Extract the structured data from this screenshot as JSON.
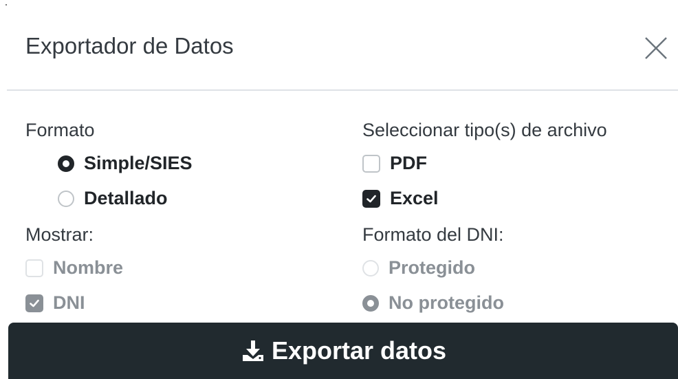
{
  "dialog": {
    "title": "Exportador de Datos",
    "close_icon": "close-icon"
  },
  "format": {
    "label": "Formato",
    "options": [
      {
        "label": "Simple/SIES",
        "checked": true,
        "disabled": false
      },
      {
        "label": "Detallado",
        "checked": false,
        "disabled": false
      }
    ]
  },
  "file_types": {
    "label": "Seleccionar tipo(s) de archivo",
    "options": [
      {
        "label": "PDF",
        "checked": false,
        "disabled": false
      },
      {
        "label": "Excel",
        "checked": true,
        "disabled": false
      }
    ]
  },
  "show": {
    "label": "Mostrar:",
    "options": [
      {
        "label": "Nombre",
        "checked": false,
        "disabled": true
      },
      {
        "label": "DNI",
        "checked": true,
        "disabled": true
      }
    ]
  },
  "dni_format": {
    "label": "Formato del DNI:",
    "options": [
      {
        "label": "Protegido",
        "checked": false,
        "disabled": true
      },
      {
        "label": "No protegido",
        "checked": true,
        "disabled": true
      }
    ]
  },
  "export_button": {
    "label": "Exportar datos",
    "icon": "download-icon"
  },
  "colors": {
    "primary_dark": "#212a2f",
    "disabled": "#8a9096",
    "divider": "#dee2e6"
  }
}
